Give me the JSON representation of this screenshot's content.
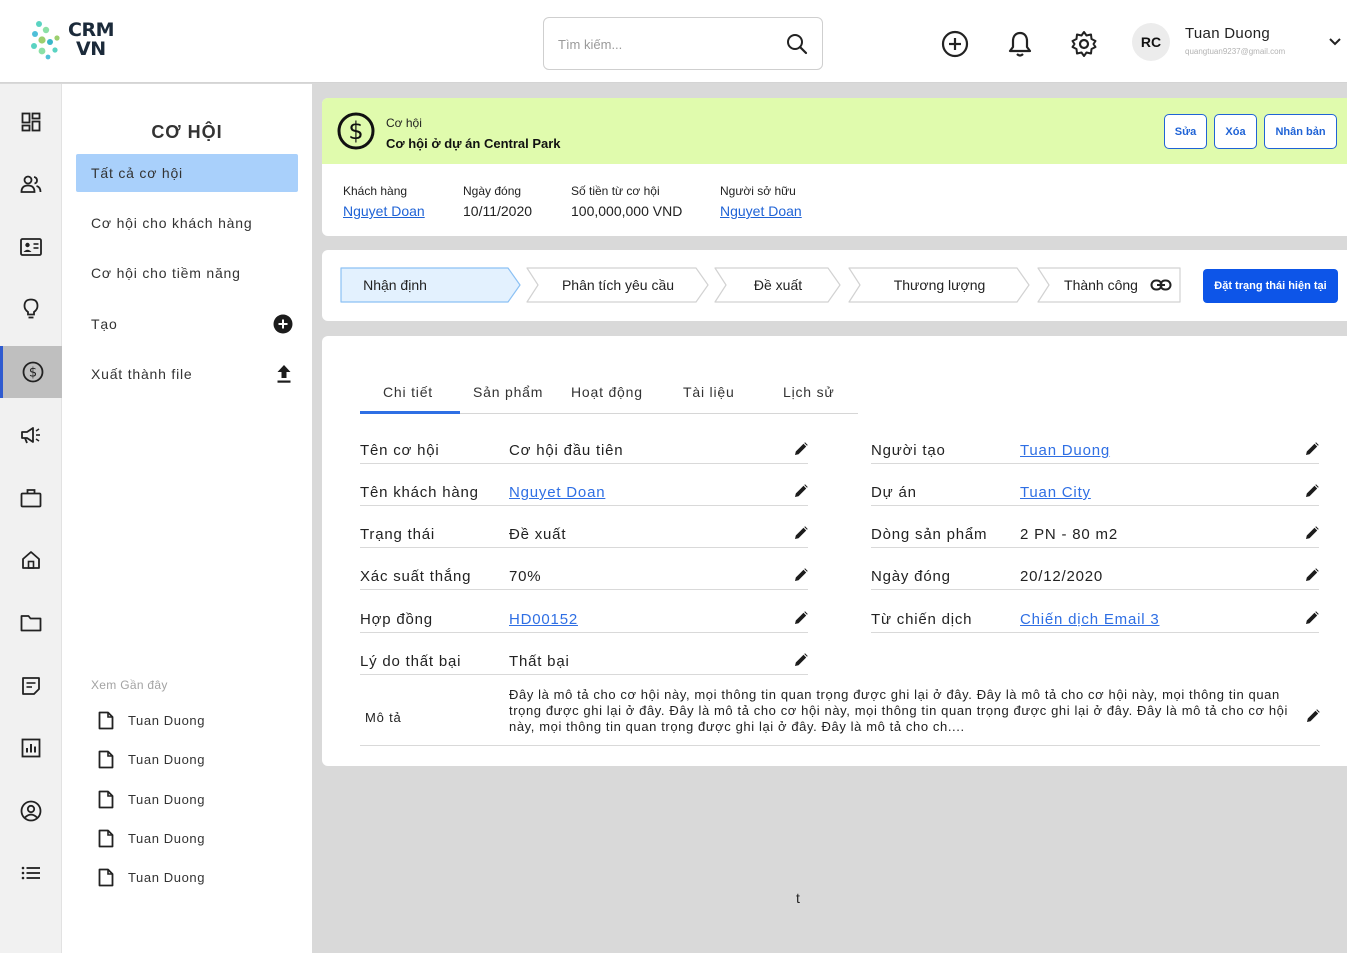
{
  "header": {
    "logo_line1": "CRM",
    "logo_line2": "VN",
    "search_placeholder": "Tìm kiếm...",
    "user": {
      "initials": "RC",
      "name": "Tuan Duong",
      "email": "quangtuan9237@gmail.com"
    }
  },
  "sidebar": {
    "title": "CƠ HỘI",
    "items": [
      {
        "label": "Tất cả cơ hội"
      },
      {
        "label": "Cơ hội cho khách hàng"
      },
      {
        "label": "Cơ hội cho tiềm năng"
      },
      {
        "label": "Tạo"
      },
      {
        "label": "Xuất thành file"
      }
    ],
    "recent_title": "Xem Gần đây",
    "recent": [
      "Tuan Duong",
      "Tuan Duong",
      "Tuan Duong",
      "Tuan Duong",
      "Tuan Duong"
    ]
  },
  "record": {
    "type_label": "Cơ hội",
    "name": "Cơ hội ở dự án Central Park",
    "buttons": {
      "edit": "Sửa",
      "delete": "Xóa",
      "clone": "Nhân bản"
    },
    "meta": [
      {
        "label": "Khách hàng",
        "value": "Nguyet Doan"
      },
      {
        "label": "Ngày đóng",
        "value": "10/11/2020"
      },
      {
        "label": "Số tiền từ cơ hội",
        "value": "100,000,000 VND"
      },
      {
        "label": "Người sở hữu",
        "value": "Nguyet Doan"
      }
    ]
  },
  "stages": {
    "items": [
      "Nhận định",
      "Phân tích yêu cầu",
      "Đề xuất",
      "Thương lượng",
      "Thành công"
    ],
    "active_index": 0,
    "set_button": "Đặt trạng thái hiện tại"
  },
  "tabs": [
    "Chi tiết",
    "Sản phẩm",
    "Hoạt động",
    "Tài liệu",
    "Lịch sử"
  ],
  "details": {
    "left": [
      {
        "label": "Tên cơ hội",
        "value": "Cơ hội đầu tiên"
      },
      {
        "label": "Tên khách hàng",
        "value": "Nguyet Doan"
      },
      {
        "label": "Trạng thái",
        "value": "Đề xuất"
      },
      {
        "label": "Xác suất thắng",
        "value": "70%"
      },
      {
        "label": "Hợp đồng",
        "value": "HD00152"
      },
      {
        "label": "Lý do thất bại",
        "value": "Thất bại"
      }
    ],
    "right": [
      {
        "label": "Người tạo",
        "value": "Tuan Duong"
      },
      {
        "label": "Dự án",
        "value": "Tuan City"
      },
      {
        "label": "Dòng sản phẩm",
        "value": "2 PN - 80 m2"
      },
      {
        "label": "Ngày đóng",
        "value": "20/12/2020"
      },
      {
        "label": "Từ chiến dịch",
        "value": "Chiến dịch Email 3"
      }
    ],
    "description_label": "Mô tả",
    "description": "Đây là mô tả cho cơ hội này, mọi thông tin quan trọng được ghi lại ở đây. Đây là mô tả cho cơ hội này, mọi thông tin quan trọng được ghi lại ở đây. Đây là mô tả cho cơ hội này, mọi thông tin quan trọng được ghi lại ở đây. Đây là mô tả cho cơ hội này, mọi thông tin quan trọng được ghi lại ở đây. Đây là mô tả cho ch...."
  },
  "stray_text": "t",
  "colors": {
    "accent": "#1f63d6",
    "active_menu": "#a9d0fb",
    "header_band": "#e0fbad",
    "primary_button": "#0d55e8"
  }
}
